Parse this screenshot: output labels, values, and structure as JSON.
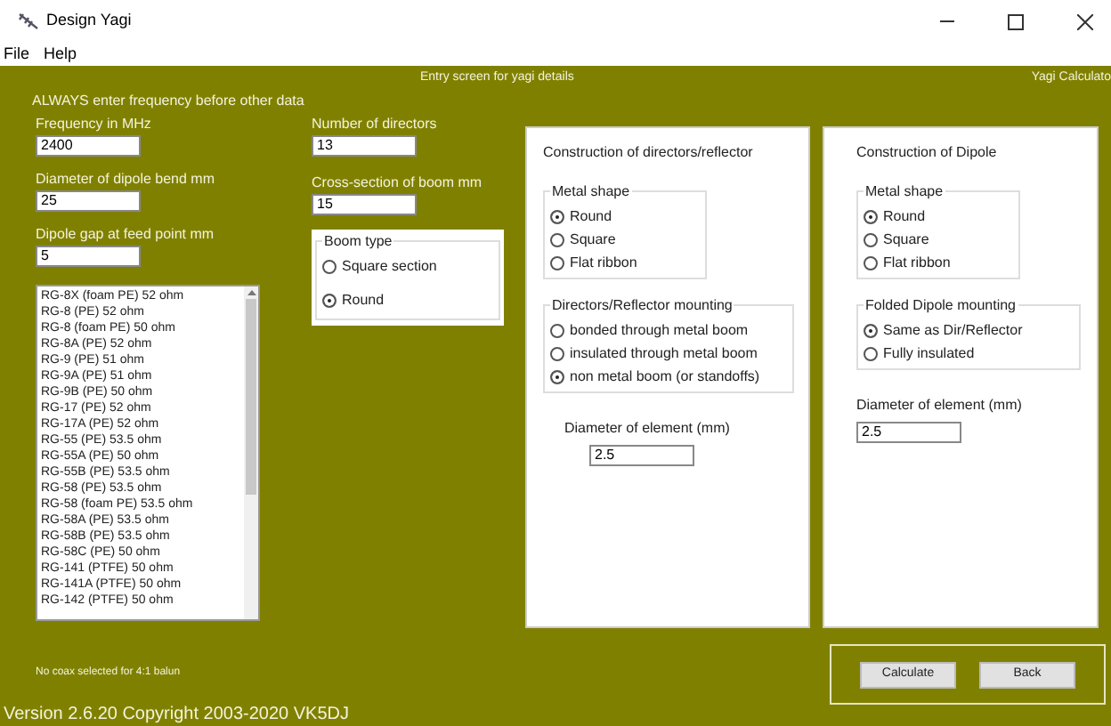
{
  "window": {
    "title": "Design Yagi"
  },
  "menu": [
    "File",
    "Help"
  ],
  "header": {
    "title": "Entry screen for yagi details",
    "app_label": "Yagi Calculato"
  },
  "notice": "ALWAYS enter frequency before other data",
  "left_fields": [
    {
      "label": "Frequency in MHz",
      "value": "2400"
    },
    {
      "label": "Diameter of dipole bend mm",
      "value": "25"
    },
    {
      "label": "Dipole gap at feed point mm",
      "value": "5"
    }
  ],
  "middle_fields": [
    {
      "label": "Number of directors",
      "value": "13"
    },
    {
      "label": "Cross-section of boom mm",
      "value": "15"
    }
  ],
  "boom_type": {
    "title": "Boom type",
    "options": [
      {
        "label": "Square section",
        "selected": false
      },
      {
        "label": "Round",
        "selected": true
      }
    ]
  },
  "coax_list": {
    "items": [
      "RG-8X (foam PE) 52 ohm",
      "RG-8 (PE) 52 ohm",
      "RG-8 (foam PE) 50 ohm",
      "RG-8A (PE) 52 ohm",
      "RG-9 (PE) 51 ohm",
      "RG-9A (PE) 51 ohm",
      "RG-9B (PE) 50 ohm",
      "RG-17 (PE) 52 ohm",
      "RG-17A (PE) 52 ohm",
      "RG-55 (PE) 53.5 ohm",
      "RG-55A (PE) 50 ohm",
      "RG-55B (PE) 53.5 ohm",
      "RG-58 (PE) 53.5 ohm",
      "RG-58 (foam PE) 53.5 ohm",
      "RG-58A (PE) 53.5 ohm",
      "RG-58B (PE) 53.5 ohm",
      "RG-58C (PE) 50 ohm",
      "RG-141 (PTFE) 50 ohm",
      "RG-141A (PTFE) 50 ohm",
      "RG-142 (PTFE) 50 ohm"
    ]
  },
  "coax_status": "No coax selected for 4:1 balun",
  "panels": [
    {
      "title": "Construction of directors/reflector",
      "groups": [
        {
          "title": "Metal shape",
          "options": [
            {
              "label": "Round",
              "selected": true
            },
            {
              "label": "Square",
              "selected": false
            },
            {
              "label": "Flat ribbon",
              "selected": false
            }
          ]
        },
        {
          "title": "Directors/Reflector mounting",
          "options": [
            {
              "label": "bonded through metal boom",
              "selected": false
            },
            {
              "label": "insulated through metal boom",
              "selected": false
            },
            {
              "label": "non metal boom (or standoffs)",
              "selected": true
            }
          ]
        }
      ],
      "diameter_label": "Diameter of element (mm)",
      "diameter_value": "2.5"
    },
    {
      "title": "Construction of Dipole",
      "groups": [
        {
          "title": "Metal shape",
          "options": [
            {
              "label": "Round",
              "selected": true
            },
            {
              "label": "Square",
              "selected": false
            },
            {
              "label": "Flat ribbon",
              "selected": false
            }
          ]
        },
        {
          "title": "Folded Dipole mounting",
          "options": [
            {
              "label": "Same as Dir/Reflector",
              "selected": true
            },
            {
              "label": "Fully insulated",
              "selected": false
            }
          ]
        }
      ],
      "diameter_label": "Diameter of element (mm)",
      "diameter_value": "2.5"
    }
  ],
  "buttons": [
    "Calculate",
    "Back"
  ],
  "version": "Version 2.6.20  Copyright 2003-2020 VK5DJ"
}
